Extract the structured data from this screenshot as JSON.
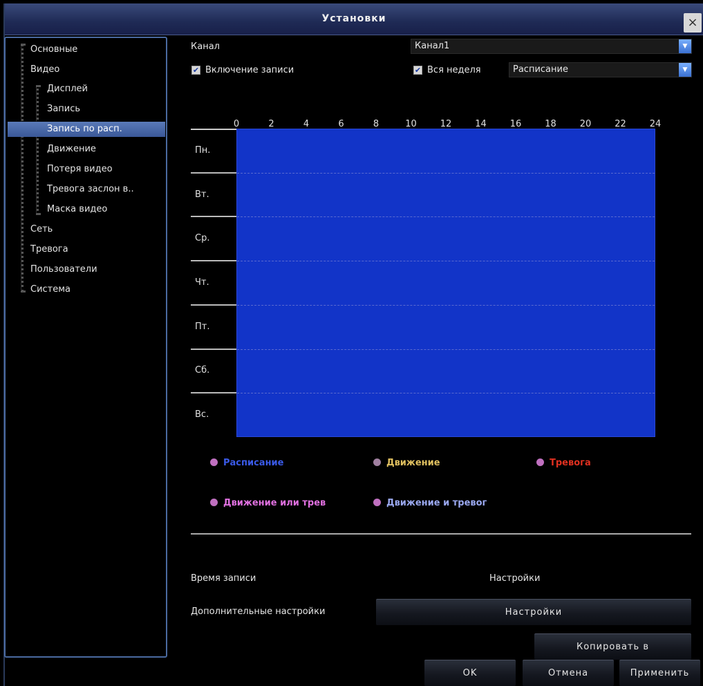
{
  "window": {
    "title": "Установки",
    "close_label": "×"
  },
  "sidebar": {
    "items": [
      {
        "label": "Основные"
      },
      {
        "label": "Видео"
      },
      {
        "label": "Дисплей"
      },
      {
        "label": "Запись"
      },
      {
        "label": "Запись по расп."
      },
      {
        "label": "Движение"
      },
      {
        "label": "Потеря видео"
      },
      {
        "label": "Тревога заслон в.."
      },
      {
        "label": "Маска видео"
      },
      {
        "label": "Сеть"
      },
      {
        "label": "Тревога"
      },
      {
        "label": "Пользователи"
      },
      {
        "label": "Система"
      }
    ],
    "selected": "Запись по расп."
  },
  "form": {
    "channel_label": "Канал",
    "channel_value": "Канал1",
    "record_enable_label": "Включение записи",
    "record_enable_checked": true,
    "whole_week_label": "Вся неделя",
    "whole_week_checked": true,
    "mode_value": "Расписание",
    "checkbox_mark": "✔",
    "dropdown_arrow": "▼"
  },
  "schedule": {
    "hours": [
      "0",
      "2",
      "4",
      "6",
      "8",
      "10",
      "12",
      "14",
      "16",
      "18",
      "20",
      "22",
      "24"
    ],
    "days": [
      "Пн.",
      "Вт.",
      "Ср.",
      "Чт.",
      "Пт.",
      "Сб.",
      "Вс."
    ],
    "fill_color": "#1234c8"
  },
  "legend": [
    {
      "label": "Расписание",
      "text_color": "#3a5ae8",
      "dot_color": "#c070c0"
    },
    {
      "label": "Движение",
      "text_color": "#e0c060",
      "dot_color": "#a080a0"
    },
    {
      "label": "Тревога",
      "text_color": "#e03020",
      "dot_color": "#c070c0"
    },
    {
      "label": "Движение или трев",
      "text_color": "#e070e0",
      "dot_color": "#c070c0"
    },
    {
      "label": "Движение и тревог",
      "text_color": "#9aa8f0",
      "dot_color": "#c070c0"
    }
  ],
  "settings": {
    "record_time_label": "Время записи",
    "record_time_value": "Настройки",
    "advanced_label": "Дополнительные настройки",
    "advanced_button": "Настройки",
    "copy_button": "Копировать в"
  },
  "footer": {
    "ok": "OK",
    "cancel": "Отмена",
    "apply": "Применить"
  }
}
